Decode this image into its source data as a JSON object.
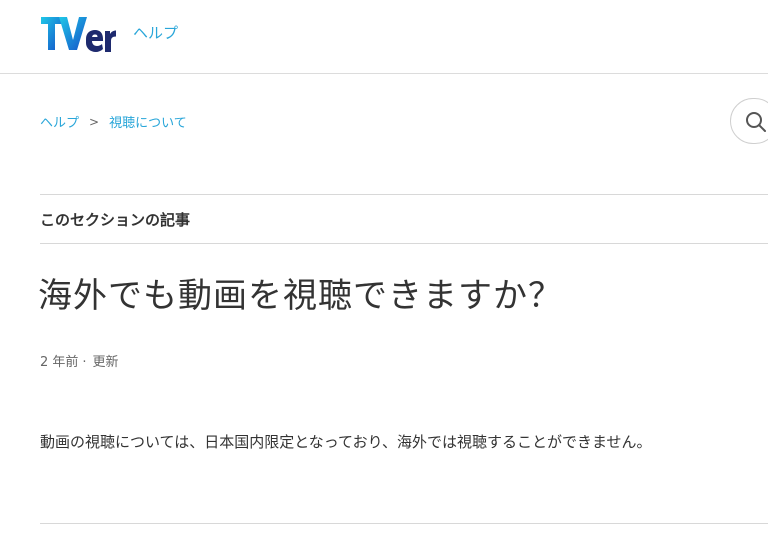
{
  "header": {
    "logo_text": "TVer",
    "help_link": "ヘルプ"
  },
  "breadcrumb": {
    "items": [
      "ヘルプ",
      "視聴について"
    ],
    "separator": ">"
  },
  "search": {
    "icon": "search-icon"
  },
  "section": {
    "title": "このセクションの記事"
  },
  "article": {
    "title": "海外でも動画を視聴できますか？",
    "meta_time": "2 年前",
    "meta_dot": "·",
    "meta_updated": "更新",
    "body": "動画の視聴については、日本国内限定となっており、海外では視聴することができません。"
  },
  "colors": {
    "accent": "#29a6d9",
    "logo_gradient_start": "#1fb4e6",
    "logo_gradient_end": "#1450c8",
    "text": "#333333"
  }
}
